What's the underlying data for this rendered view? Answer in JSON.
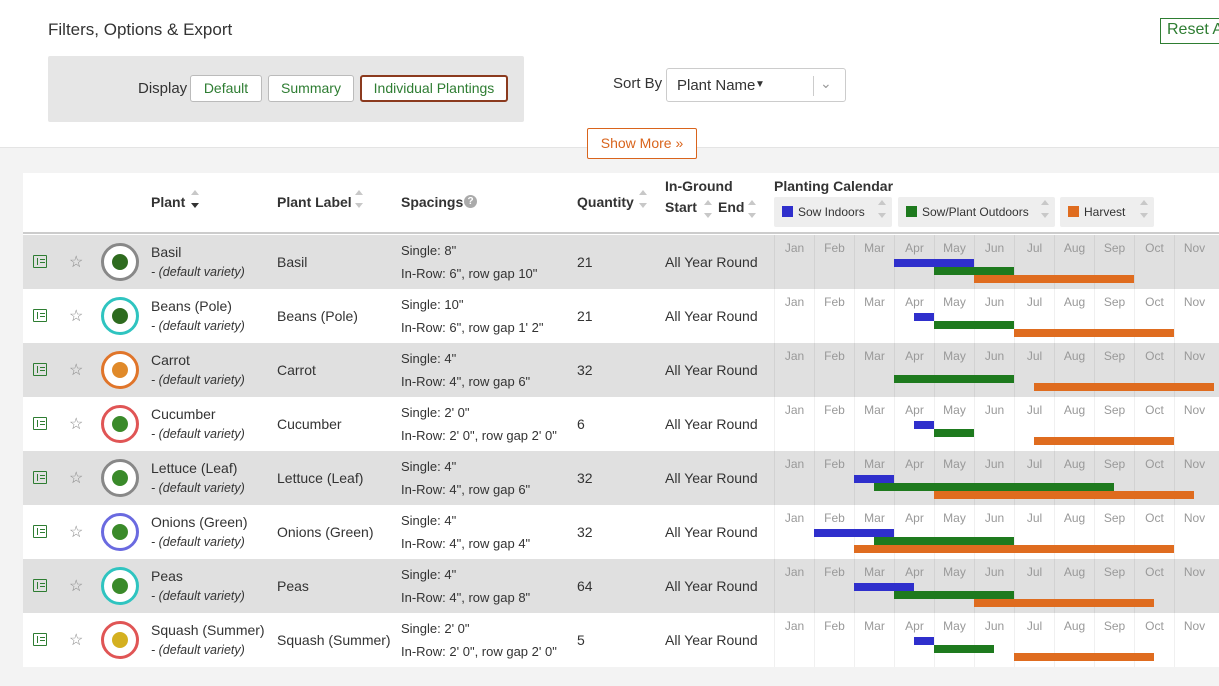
{
  "header": {
    "title": "Filters, Options & Export",
    "reset_label": "Reset A",
    "display_label": "Display",
    "display_buttons": [
      "Default",
      "Summary",
      "Individual Plantings"
    ],
    "display_selected": "Individual Plantings",
    "sort_label": "Sort By",
    "sort_value": "Plant Name",
    "show_more_label": "Show More »"
  },
  "colors": {
    "sow_indoors": "#2f2fcc",
    "sow_outdoors": "#1e7a1e",
    "harvest": "#df6c1f",
    "accent_green": "#2e7d32",
    "accent_orange": "#d9641c"
  },
  "table": {
    "headers": {
      "plant": "Plant",
      "label": "Plant Label",
      "spacings": "Spacings",
      "quantity": "Quantity",
      "inground": "In-Ground",
      "start": "Start",
      "end": "End",
      "calendar": "Planting Calendar"
    },
    "legend": [
      "Sow Indoors",
      "Sow/Plant Outdoors",
      "Harvest"
    ],
    "months": [
      "Jan",
      "Feb",
      "Mar",
      "Apr",
      "May",
      "Jun",
      "Jul",
      "Aug",
      "Sep",
      "Oct",
      "Nov"
    ],
    "rows": [
      {
        "plant": "Basil",
        "variety": "- (default variety)",
        "label": "Basil",
        "single": "Single: 8\"",
        "inrow": "In-Row: 6\", row gap 10\"",
        "quantity": "21",
        "inground": "All Year Round",
        "icon": "basil-icon",
        "ring": "#888888",
        "glyph": "#2e6b1f",
        "indoors": [
          [
            3,
            5
          ]
        ],
        "outdoors": [
          [
            4,
            6
          ]
        ],
        "harvest": [
          [
            5,
            9
          ]
        ]
      },
      {
        "plant": "Beans (Pole)",
        "variety": "- (default variety)",
        "label": "Beans (Pole)",
        "single": "Single: 10\"",
        "inrow": "In-Row: 6\", row gap 1' 2\"",
        "quantity": "21",
        "inground": "All Year Round",
        "icon": "beans-icon",
        "ring": "#2fc4c0",
        "glyph": "#2e6b1f",
        "indoors": [
          [
            3.5,
            4
          ]
        ],
        "outdoors": [
          [
            4,
            6
          ]
        ],
        "harvest": [
          [
            6,
            10
          ]
        ]
      },
      {
        "plant": "Carrot",
        "variety": "- (default variety)",
        "label": "Carrot",
        "single": "Single: 4\"",
        "inrow": "In-Row: 4\", row gap 6\"",
        "quantity": "32",
        "inground": "All Year Round",
        "icon": "carrot-icon",
        "ring": "#e0752a",
        "glyph": "#e08a2a",
        "indoors": [],
        "outdoors": [
          [
            3,
            6
          ]
        ],
        "harvest": [
          [
            6.5,
            11
          ]
        ]
      },
      {
        "plant": "Cucumber",
        "variety": "- (default variety)",
        "label": "Cucumber",
        "single": "Single: 2' 0\"",
        "inrow": "In-Row: 2' 0\", row gap 2' 0\"",
        "quantity": "6",
        "inground": "All Year Round",
        "icon": "cucumber-icon",
        "ring": "#e05555",
        "glyph": "#3a8a2a",
        "indoors": [
          [
            3.5,
            4
          ]
        ],
        "outdoors": [
          [
            4,
            5
          ]
        ],
        "harvest": [
          [
            6.5,
            10
          ]
        ]
      },
      {
        "plant": "Lettuce (Leaf)",
        "variety": "- (default variety)",
        "label": "Lettuce (Leaf)",
        "single": "Single: 4\"",
        "inrow": "In-Row: 4\", row gap 6\"",
        "quantity": "32",
        "inground": "All Year Round",
        "icon": "lettuce-icon",
        "ring": "#888888",
        "glyph": "#3a8a2a",
        "indoors": [
          [
            2,
            3
          ]
        ],
        "outdoors": [
          [
            2.5,
            8.5
          ]
        ],
        "harvest": [
          [
            4,
            10.5
          ]
        ]
      },
      {
        "plant": "Onions (Green)",
        "variety": "- (default variety)",
        "label": "Onions (Green)",
        "single": "Single: 4\"",
        "inrow": "In-Row: 4\", row gap 4\"",
        "quantity": "32",
        "inground": "All Year Round",
        "icon": "onion-icon",
        "ring": "#6a6ae0",
        "glyph": "#3a8a2a",
        "indoors": [
          [
            1,
            3
          ]
        ],
        "outdoors": [
          [
            2.5,
            6
          ]
        ],
        "harvest": [
          [
            2,
            10
          ]
        ]
      },
      {
        "plant": "Peas",
        "variety": "- (default variety)",
        "label": "Peas",
        "single": "Single: 4\"",
        "inrow": "In-Row: 4\", row gap 8\"",
        "quantity": "64",
        "inground": "All Year Round",
        "icon": "peas-icon",
        "ring": "#2fc4c0",
        "glyph": "#3a8a2a",
        "indoors": [
          [
            2,
            3.5
          ]
        ],
        "outdoors": [
          [
            3,
            6
          ]
        ],
        "harvest": [
          [
            5,
            9.5
          ]
        ]
      },
      {
        "plant": "Squash (Summer)",
        "variety": "- (default variety)",
        "label": "Squash (Summer)",
        "single": "Single: 2' 0\"",
        "inrow": "In-Row: 2' 0\", row gap 2' 0\"",
        "quantity": "5",
        "inground": "All Year Round",
        "icon": "squash-icon",
        "ring": "#e05555",
        "glyph": "#d4b020",
        "indoors": [
          [
            3.5,
            4
          ]
        ],
        "outdoors": [
          [
            4,
            5.5
          ]
        ],
        "harvest": [
          [
            6,
            9.5
          ]
        ]
      }
    ]
  }
}
